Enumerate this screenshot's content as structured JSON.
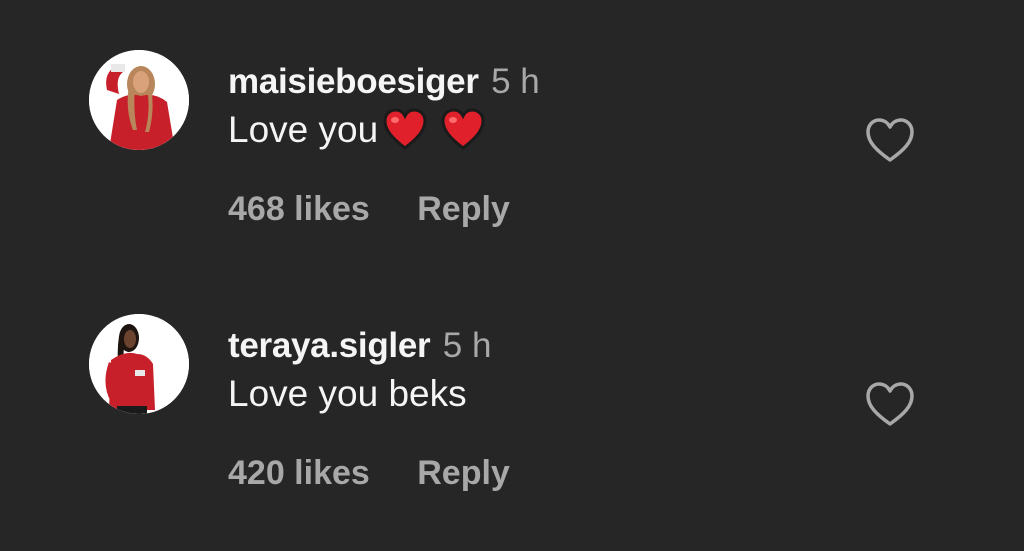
{
  "comments": [
    {
      "username": "maisieboesiger",
      "time": "5 h",
      "text": "Love you",
      "emoji": [
        "red-heart",
        "red-heart"
      ],
      "likes": "468 likes",
      "reply": "Reply"
    },
    {
      "username": "teraya.sigler",
      "time": "5 h",
      "text": "Love you beks",
      "emoji": [],
      "likes": "420 likes",
      "reply": "Reply"
    }
  ],
  "colors": {
    "background": "#262626",
    "primary_text": "#f5f5f5",
    "secondary_text": "#a8a8a8",
    "heart_emoji": "#e0202a"
  }
}
